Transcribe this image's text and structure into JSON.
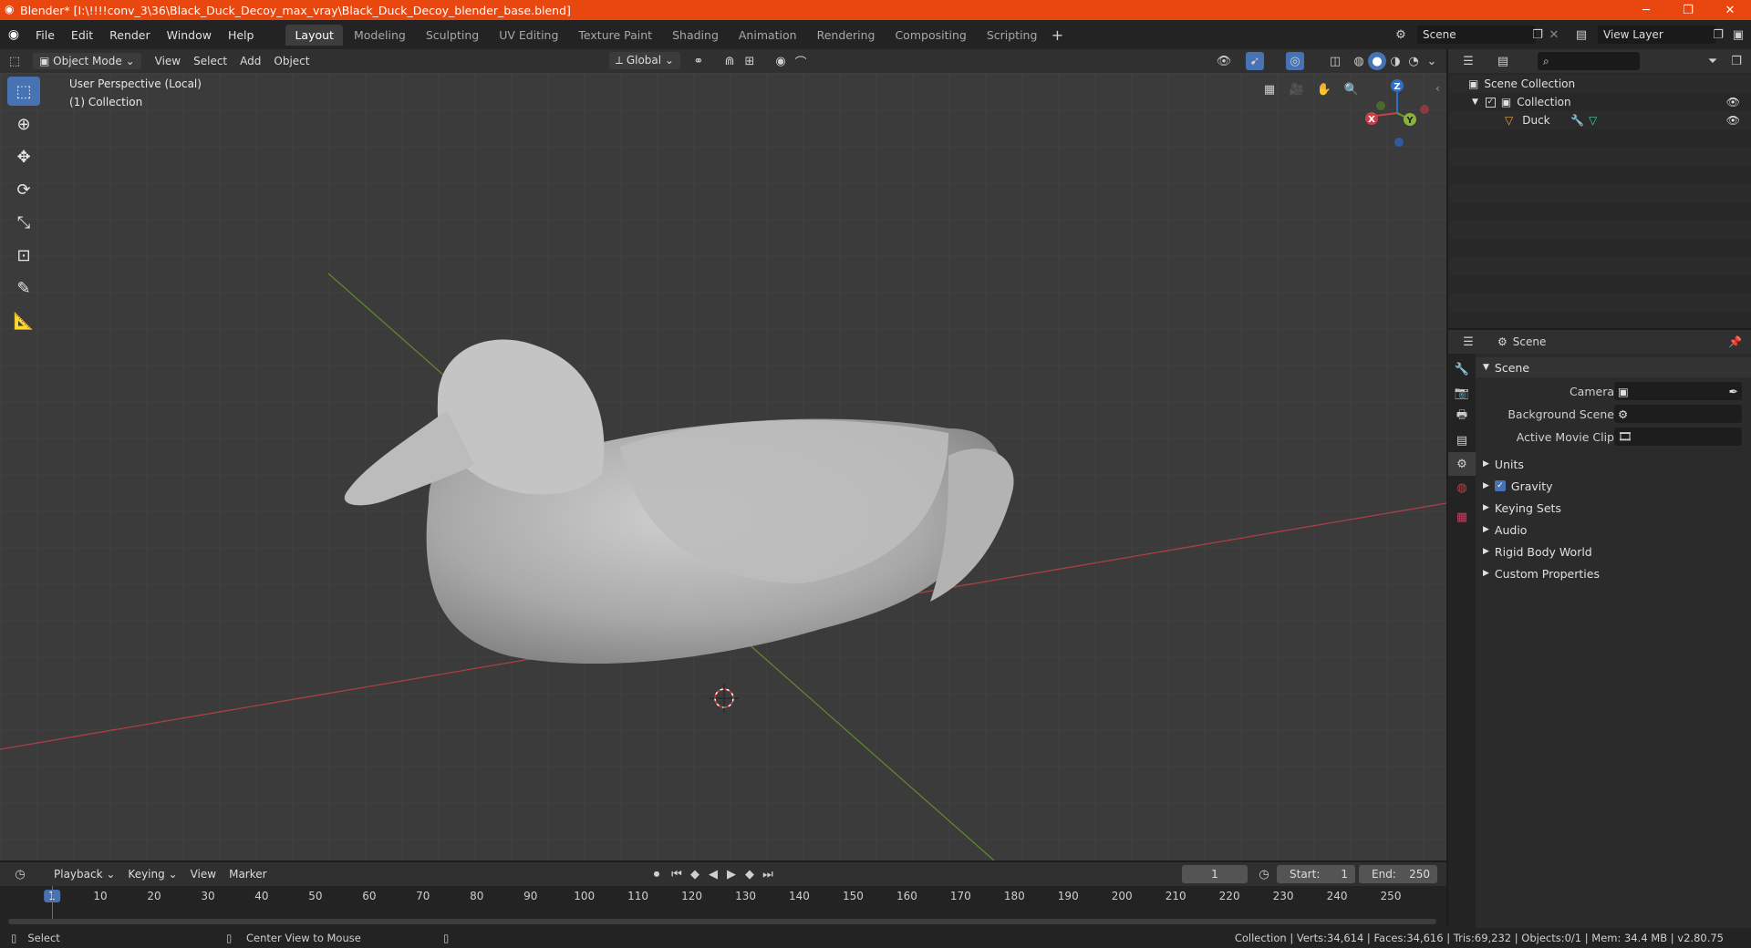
{
  "window": {
    "title": "Blender* [I:\\!!!!conv_3\\36\\Black_Duck_Decoy_max_vray\\Black_Duck_Decoy_blender_base.blend]"
  },
  "menu": [
    "File",
    "Edit",
    "Render",
    "Window",
    "Help"
  ],
  "workspaces": [
    "Layout",
    "Modeling",
    "Sculpting",
    "UV Editing",
    "Texture Paint",
    "Shading",
    "Animation",
    "Rendering",
    "Compositing",
    "Scripting"
  ],
  "scene_field": "Scene",
  "view_layer_field": "View Layer",
  "viewport_header": {
    "mode": "Object Mode",
    "menus": [
      "View",
      "Select",
      "Add",
      "Object"
    ],
    "orientation": "Global"
  },
  "viewport": {
    "perspective": "User Perspective (Local)",
    "collection": "(1) Collection",
    "gizmo": {
      "x": "X",
      "y": "Y",
      "z": "Z"
    }
  },
  "outliner": {
    "scene_collection": "Scene Collection",
    "collection": "Collection",
    "object": "Duck"
  },
  "properties": {
    "header": "Scene",
    "section": "Scene",
    "fields": [
      {
        "label": "Camera"
      },
      {
        "label": "Background Scene"
      },
      {
        "label": "Active Movie Clip"
      }
    ],
    "panels": [
      "Units",
      "Gravity",
      "Keying Sets",
      "Audio",
      "Rigid Body World",
      "Custom Properties"
    ]
  },
  "timeline": {
    "menus": [
      "Playback",
      "Keying",
      "View",
      "Marker"
    ],
    "current_frame": "1",
    "start_label": "Start:",
    "start": "1",
    "end_label": "End:",
    "end": "250",
    "ticks": [
      "1",
      "10",
      "20",
      "30",
      "40",
      "50",
      "60",
      "70",
      "80",
      "90",
      "100",
      "110",
      "120",
      "130",
      "140",
      "150",
      "160",
      "170",
      "180",
      "190",
      "200",
      "210",
      "220",
      "230",
      "240",
      "250"
    ]
  },
  "status": {
    "left": "Select",
    "middle": "Center View to Mouse",
    "right": "Collection | Verts:34,614 | Faces:34,616 | Tris:69,232 | Objects:0/1 | Mem: 34.4 MB | v2.80.75"
  },
  "colors": {
    "accent": "#4772b3",
    "titlebar": "#e8470f",
    "x_axis": "#c8404a",
    "y_axis": "#6a9a2a",
    "z_axis": "#2f6fc8"
  }
}
